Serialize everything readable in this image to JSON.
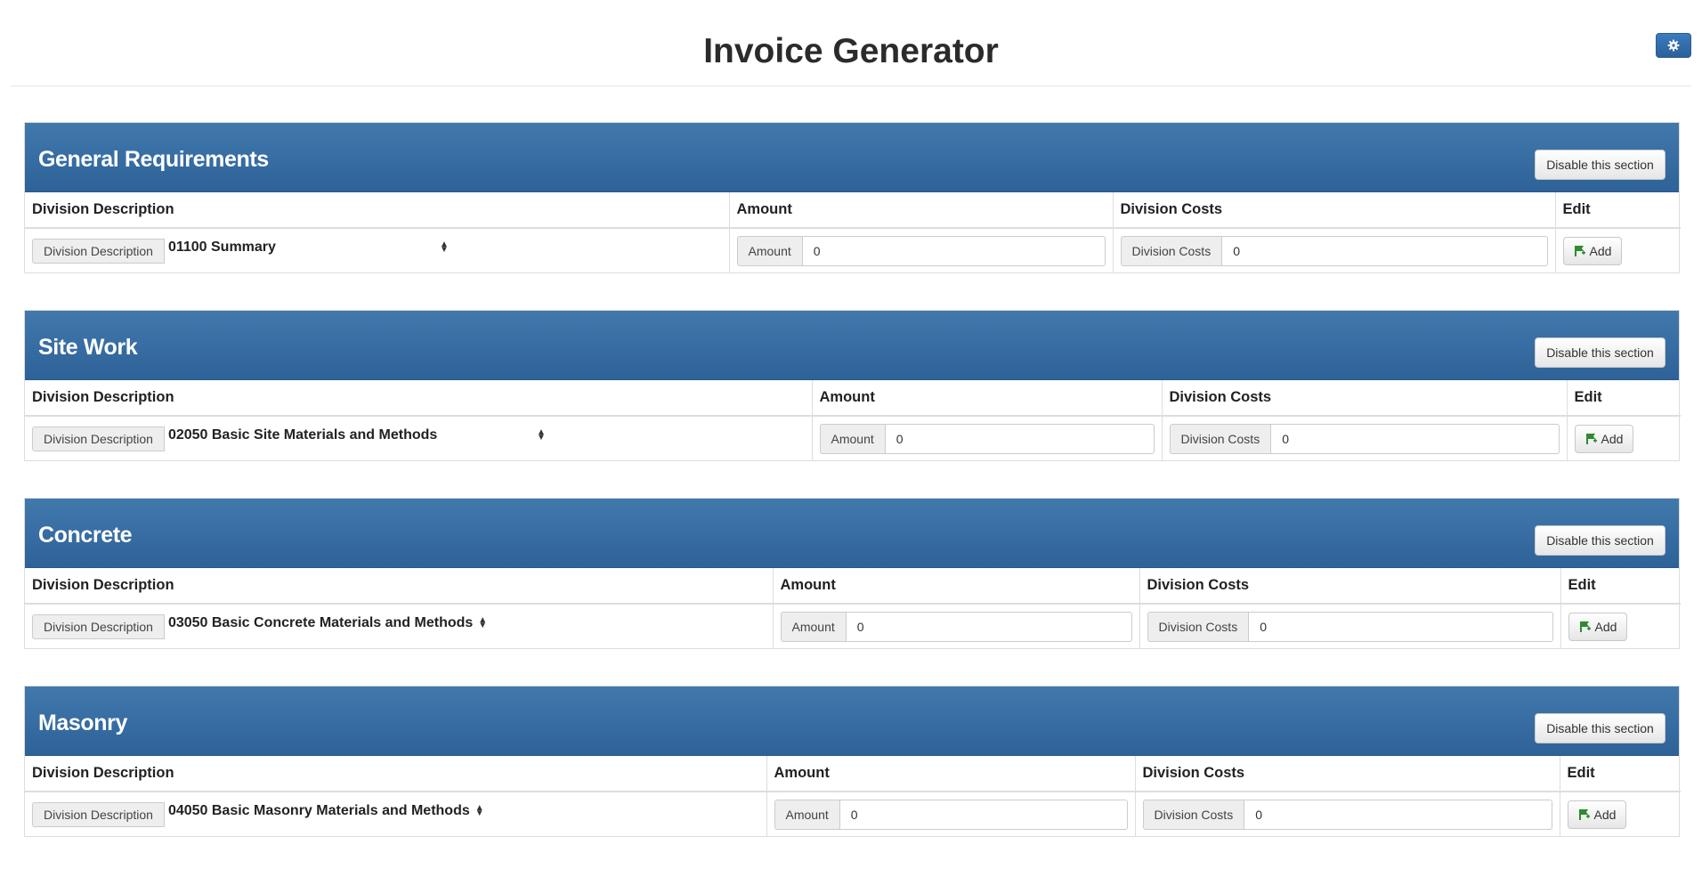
{
  "header": {
    "title": "Invoice Generator",
    "settings_icon": "gear-icon"
  },
  "colors": {
    "section_header": "#3569a0",
    "settings_button": "#3573b1",
    "add_icon": "#2e8b2e"
  },
  "labels": {
    "disable_button": "Disable this section",
    "col_description": "Division Description",
    "col_amount": "Amount",
    "col_costs": "Division Costs",
    "col_edit": "Edit",
    "addon_description": "Division Description",
    "addon_amount": "Amount",
    "addon_costs": "Division Costs",
    "add_button": "Add",
    "add_icon": "flag-plus-icon"
  },
  "sections": [
    {
      "title": "General Requirements",
      "division": "01100 Summary",
      "amount": "0",
      "costs": "0"
    },
    {
      "title": "Site Work",
      "division": "02050 Basic Site Materials and Methods",
      "amount": "0",
      "costs": "0"
    },
    {
      "title": "Concrete",
      "division": "03050 Basic Concrete Materials and Methods",
      "amount": "0",
      "costs": "0"
    },
    {
      "title": "Masonry",
      "division": "04050 Basic Masonry Materials and Methods",
      "amount": "0",
      "costs": "0"
    }
  ]
}
